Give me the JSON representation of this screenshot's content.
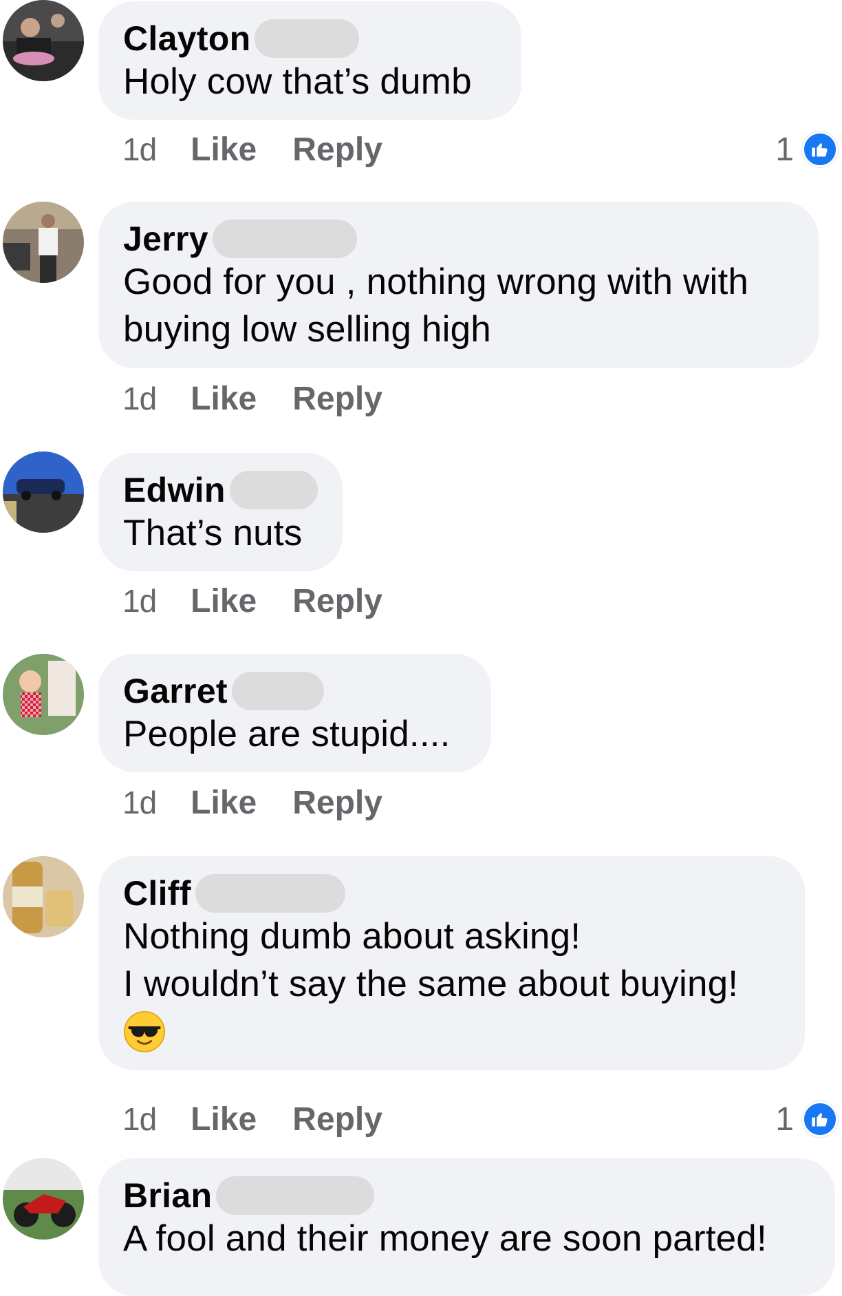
{
  "comments": [
    {
      "name": "Clayton",
      "lines": [
        "Holy cow that’s dumb"
      ],
      "time": "1d",
      "like_label": "Like",
      "reply_label": "Reply",
      "reaction_count": "1"
    },
    {
      "name": "Jerry",
      "lines": [
        "Good for you , nothing wrong with with",
        "buying low selling high"
      ],
      "time": "1d",
      "like_label": "Like",
      "reply_label": "Reply"
    },
    {
      "name": "Edwin",
      "lines": [
        "That’s nuts"
      ],
      "time": "1d",
      "like_label": "Like",
      "reply_label": "Reply"
    },
    {
      "name": "Garret",
      "lines": [
        "People are stupid...."
      ],
      "time": "1d",
      "like_label": "Like",
      "reply_label": "Reply"
    },
    {
      "name": "Cliff",
      "lines": [
        "Nothing dumb about asking!",
        "I wouldn’t say the same about buying!"
      ],
      "emoji": "sunglasses-emoji",
      "time": "1d",
      "like_label": "Like",
      "reply_label": "Reply",
      "reaction_count": "1"
    },
    {
      "name": "Brian",
      "lines": [
        "A fool and their money are soon parted!"
      ]
    }
  ],
  "colors": {
    "bubble": "#f0f2f5",
    "meta_text": "#65676b",
    "like_blue": "#1877f2",
    "redaction": "#dcdcdd"
  },
  "icons": {
    "reaction": "thumbs-up-icon"
  }
}
